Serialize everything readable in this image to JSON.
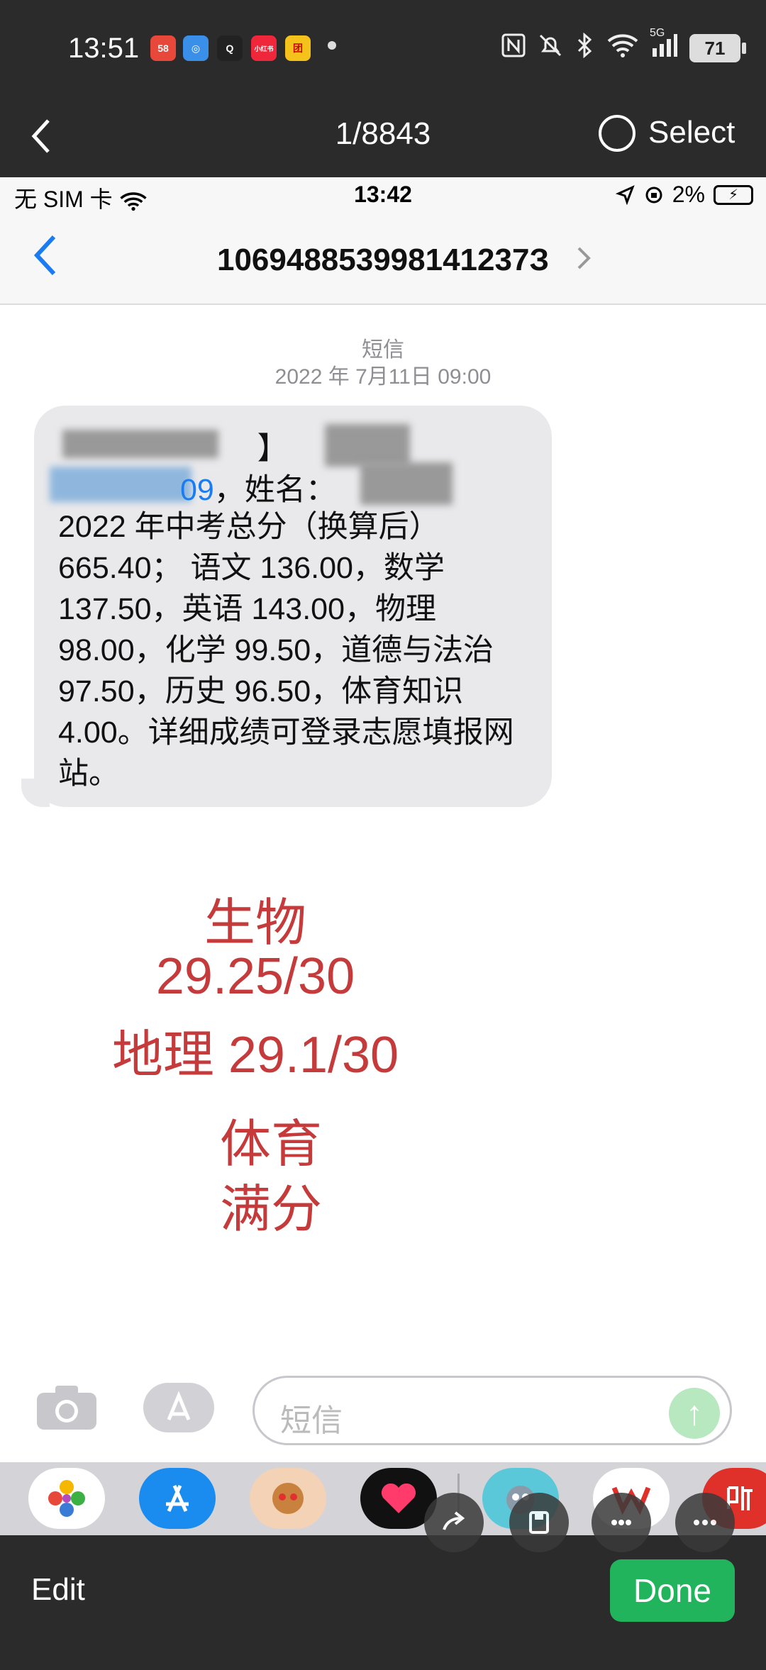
{
  "outer_status": {
    "time": "13:51",
    "apps": [
      {
        "label": "58",
        "color": "#e8483a"
      },
      {
        "label": "◎",
        "color": "#3a8fe8"
      },
      {
        "label": "Q",
        "color": "#222222"
      },
      {
        "label": "小红书",
        "color": "#f0263a"
      },
      {
        "label": "团",
        "color": "#f5c21b"
      }
    ],
    "icons": [
      "nfc-icon",
      "mute-icon",
      "bluetooth-icon",
      "wifi-icon",
      "signal-icon"
    ],
    "signal_label": "5G",
    "battery": "71"
  },
  "viewer": {
    "counter": "1/8843",
    "select_label": "Select",
    "edit_label": "Edit",
    "done_label": "Done"
  },
  "ios_status": {
    "carrier": "无 SIM 卡",
    "time": "13:42",
    "battery_pct": "2%"
  },
  "conversation": {
    "title": "106948853998141237З",
    "label": "短信",
    "date": "2022 年 7月11日 09:00",
    "line1_visible": "【",
    "line1_tail": "】",
    "line2_link": "09",
    "line2_name": "，姓名：",
    "body": "2022 年中考总分（换算后）665.40； 语文 136.00，数学 137.50，英语 143.00，物理 98.00，化学 99.50，道德与法治 97.50，历史 96.50，体育知识 4.00。详细成绩可登录志愿填报网站。",
    "input_placeholder": "短信"
  },
  "annotation": {
    "line1": "生物",
    "line2": "29.25/30",
    "line3": "地理 29.1/30",
    "line4": "体育",
    "line5": "满分",
    "color": "#c53a3a"
  }
}
